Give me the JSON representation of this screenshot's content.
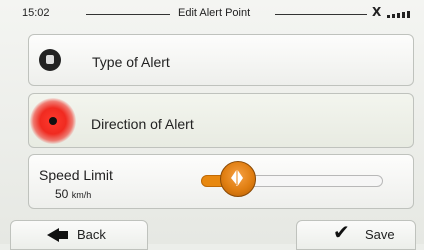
{
  "topbar": {
    "time": "15:02",
    "title": "Edit Alert Point",
    "status_glyph": "𝗫",
    "signal_icon": "signal-bars-icon"
  },
  "items": {
    "type": {
      "label": "Type of Alert",
      "icon": "alert-type-icon"
    },
    "direction": {
      "label": "Direction of Alert",
      "icon": "direction-marker-icon",
      "accent": "#f02a20"
    },
    "speed": {
      "label": "Speed Limit",
      "value": "50",
      "unit": "km/h",
      "slider_fraction": 0.2,
      "accent": "#e8880f"
    }
  },
  "footer": {
    "back_label": "Back",
    "save_label": "Save"
  }
}
